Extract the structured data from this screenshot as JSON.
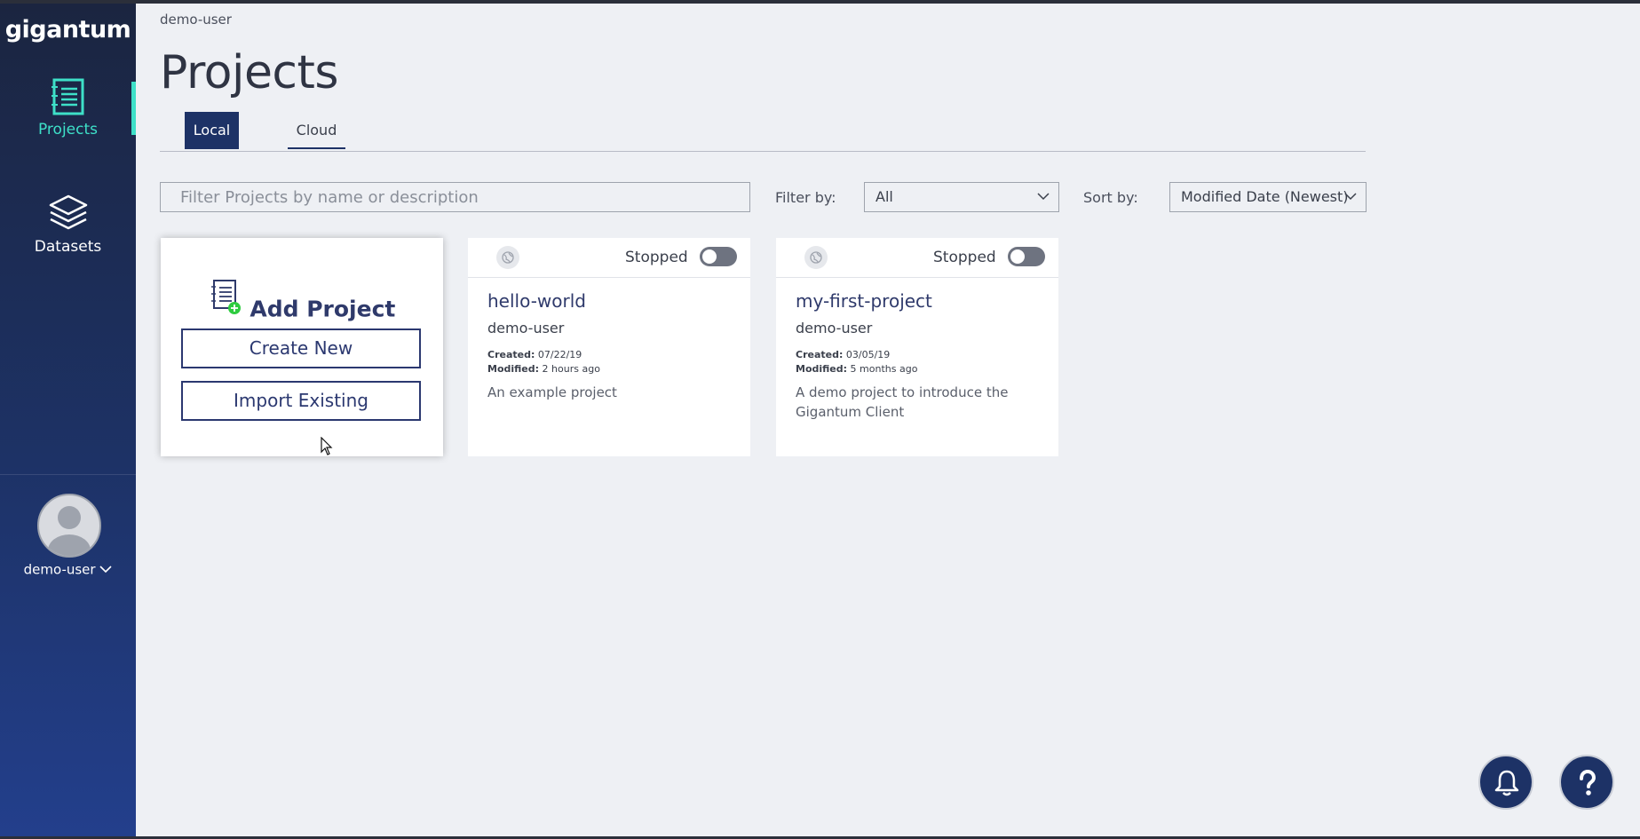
{
  "app": {
    "logo_text": "gigantum"
  },
  "sidebar": {
    "items": [
      {
        "label": "Projects",
        "icon": "notebook-icon",
        "active": true
      },
      {
        "label": "Datasets",
        "icon": "layers-icon",
        "active": false
      }
    ],
    "user": {
      "name": "demo-user",
      "icon": "avatar-icon"
    }
  },
  "header": {
    "breadcrumb": "demo-user",
    "title": "Projects"
  },
  "tabs": [
    {
      "label": "Local",
      "selected": true
    },
    {
      "label": "Cloud",
      "selected": false
    }
  ],
  "filters": {
    "search_placeholder": "Filter Projects by name or description",
    "filter_label": "Filter by:",
    "filter_value": "All",
    "sort_label": "Sort by:",
    "sort_value": "Modified Date (Newest)"
  },
  "add_project": {
    "title": "Add Project",
    "create_label": "Create New",
    "import_label": "Import Existing"
  },
  "projects": [
    {
      "status": "Stopped",
      "name": "hello-world",
      "owner": "demo-user",
      "created_label": "Created:",
      "created": "07/22/19",
      "modified_label": "Modified:",
      "modified": "2 hours ago",
      "description": "An example project"
    },
    {
      "status": "Stopped",
      "name": "my-first-project",
      "owner": "demo-user",
      "created_label": "Created:",
      "created": "03/05/19",
      "modified_label": "Modified:",
      "modified": "5 months ago",
      "description": "A demo project to introduce the Gigantum Client"
    }
  ],
  "colors": {
    "sidebar_dark": "#1b2540",
    "accent_teal": "#3ee0c8",
    "navy": "#1d3266",
    "add_badge_green": "#2ecc40"
  },
  "floating": {
    "bell_icon": "bell-icon",
    "help_icon": "question-icon"
  }
}
